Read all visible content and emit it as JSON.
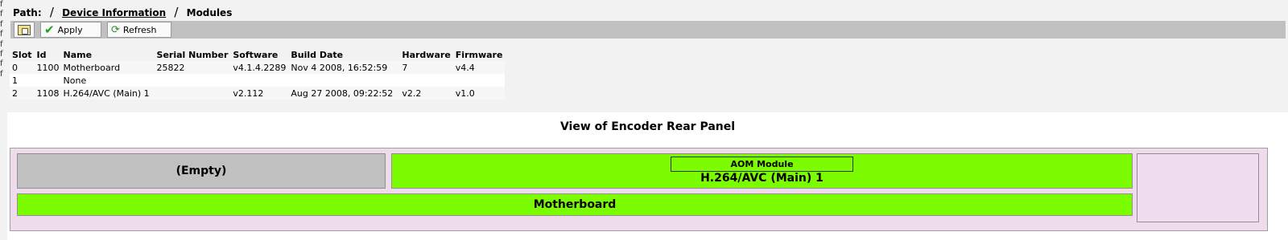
{
  "left_frame": [
    "f",
    "f",
    "f",
    "f",
    "f",
    "f",
    "f",
    "f"
  ],
  "breadcrumb": {
    "prefix": "Path:",
    "sep": "/",
    "link": "Device Information",
    "current": "Modules"
  },
  "toolbar": {
    "apply_label": "Apply",
    "refresh_label": "Refresh"
  },
  "table": {
    "headers": [
      "Slot",
      "Id",
      "Name",
      "Serial Number",
      "Software",
      "Build Date",
      "Hardware",
      "Firmware"
    ],
    "rows": [
      [
        "0",
        "1100",
        "Motherboard",
        "25822",
        "v4.1.4.2289",
        "Nov 4 2008, 16:52:59",
        "7",
        "v4.4"
      ],
      [
        "1",
        "",
        "None",
        "",
        "",
        "",
        "",
        ""
      ],
      [
        "2",
        "1108",
        "H.264/AVC (Main) 1",
        "",
        "v2.112",
        "Aug 27 2008, 09:22:52",
        "v2.2",
        "v1.0"
      ]
    ]
  },
  "panel": {
    "title": "View of Encoder Rear Panel",
    "empty_slot": "(Empty)",
    "aom_label": "AOM Module",
    "aom_name": "H.264/AVC (Main) 1",
    "motherboard": "Motherboard"
  },
  "colors": {
    "module_active": "#7cfc00",
    "module_empty": "#c0c0c0",
    "panel_bg": "#eedcec",
    "toolbar": "#c0c0c0"
  }
}
